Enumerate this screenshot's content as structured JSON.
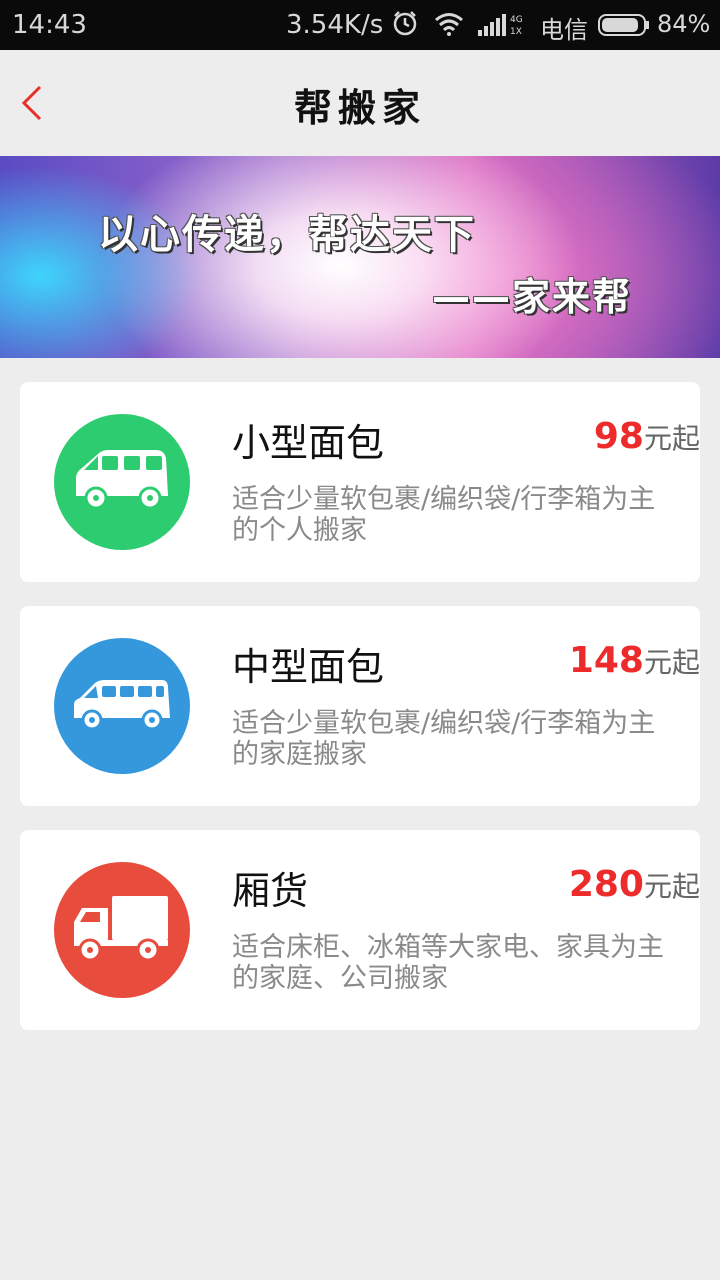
{
  "status_bar": {
    "time": "14:43",
    "net_speed": "3.54K/s",
    "signal_type": "4G 1X",
    "carrier": "电信",
    "battery": "84%"
  },
  "header": {
    "title": "帮搬家"
  },
  "banner": {
    "slogan": "以心传递，帮达天下",
    "signature": "——家来帮"
  },
  "services": [
    {
      "name": "小型面包",
      "price": "98",
      "price_suffix": "元起",
      "desc": "适合少量软包裹/编织袋/行李箱为主的个人搬家",
      "icon": "small-van-icon",
      "color": "#2ecc71"
    },
    {
      "name": "中型面包",
      "price": "148",
      "price_suffix": "元起",
      "desc": "适合少量软包裹/编织袋/行李箱为主的家庭搬家",
      "icon": "medium-van-icon",
      "color": "#3598dc"
    },
    {
      "name": "厢货",
      "price": "280",
      "price_suffix": "元起",
      "desc": "适合床柜、冰箱等大家电、家具为主的家庭、公司搬家",
      "icon": "box-truck-icon",
      "color": "#e74c3c"
    }
  ],
  "colors": {
    "accent": "#ee2b2b",
    "background": "#ecedec"
  }
}
